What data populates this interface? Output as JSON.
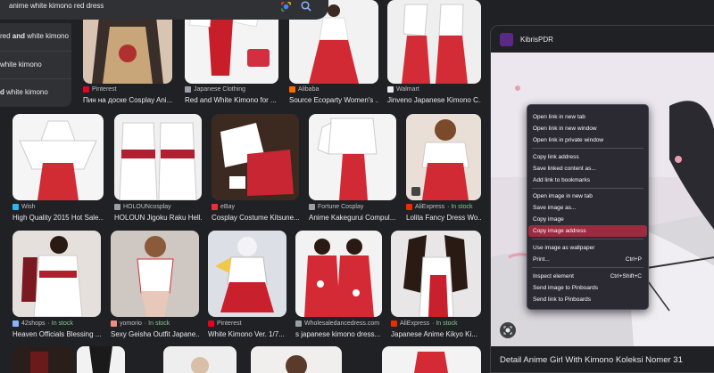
{
  "search": {
    "query": "anime white kimono red dress"
  },
  "suggestions": [
    {
      "prefix": "red ",
      "bold": "and",
      "suffix": " white kimono"
    },
    {
      "prefix": "white kimono",
      "bold": "",
      "suffix": ""
    },
    {
      "prefix": "",
      "bold": "d",
      "suffix": " white kimono"
    }
  ],
  "results": {
    "row1": [
      {
        "source": "Pinterest",
        "title": "Пин на доске Cosplay Ani...",
        "fav": "#e60023"
      },
      {
        "source": "Japanese Clothing",
        "title": "Red and White Kimono for ...",
        "fav": "#9aa0a6"
      },
      {
        "source": "Alibaba",
        "title": "Source Ecoparty Women's ...",
        "fav": "#ff6a00"
      },
      {
        "source": "Walmart",
        "title": "Jinveno Japanese Kimono C...",
        "fav": "#e8eaed"
      }
    ],
    "row2": [
      {
        "source": "Wish",
        "title": "High Quality 2015 Hot Sale...",
        "fav": "#2fb7ec",
        "stock": ""
      },
      {
        "source": "HOLOUNcosplay",
        "title": "HOLOUN Jigoku Raku Hell...",
        "fav": "#9aa0a6",
        "stock": ""
      },
      {
        "source": "eBay",
        "title": "Cosplay Costume Kitsune...",
        "fav": "#e53238",
        "stock": ""
      },
      {
        "source": "Fortune Cosplay",
        "title": "Anime Kakegurui Compul...",
        "fav": "#9aa0a6",
        "stock": ""
      },
      {
        "source": "AliExpress",
        "title": "Lolita Fancy Dress Wo...",
        "fav": "#e62e04",
        "stock": "· In stock"
      }
    ],
    "row3": [
      {
        "source": "42shops",
        "title": "Heaven Officials Blessing ...",
        "fav": "#8ab4f8",
        "stock": "· In stock"
      },
      {
        "source": "yomorio",
        "title": "Sexy Geisha Outfit Japane...",
        "fav": "#f28b82",
        "stock": "· In stock"
      },
      {
        "source": "Pinterest",
        "title": "White Kimono Ver. 1/7...",
        "fav": "#e60023",
        "stock": ""
      },
      {
        "source": "Wholesaledancedress.com",
        "title": "s japanese kimono dress...",
        "fav": "#9aa0a6",
        "stock": ""
      },
      {
        "source": "AliExpress",
        "title": "Japanese Anime Kikyo Ki...",
        "fav": "#e62e04",
        "stock": "· In stock"
      }
    ]
  },
  "preview": {
    "site": "KibrisPDR",
    "title": "Detail Anime Girl With Kimono Koleksi Nomer 31"
  },
  "context_menu": {
    "group1": [
      "Open link in new tab",
      "Open link in new window",
      "Open link in private window"
    ],
    "group2": [
      "Copy link address",
      "Save linked content as...",
      "Add link to bookmarks"
    ],
    "group3": [
      "Open image in new tab",
      "Save image as...",
      "Copy image",
      "Copy image address"
    ],
    "group4": [
      "Use image as wallpaper"
    ],
    "print": {
      "label": "Print...",
      "shortcut": "Ctrl+P"
    },
    "group5": [
      {
        "label": "Inspect element",
        "shortcut": "Ctrl+Shift+C"
      },
      {
        "label": "Send image to Pinboards",
        "shortcut": ""
      },
      {
        "label": "Send link to Pinboards",
        "shortcut": ""
      }
    ],
    "highlighted": "Copy image address"
  },
  "colors": {
    "background": "#202124",
    "menu_background": "#2b2a33",
    "menu_highlight": "#9b2c3f",
    "in_stock": "#81c995"
  }
}
